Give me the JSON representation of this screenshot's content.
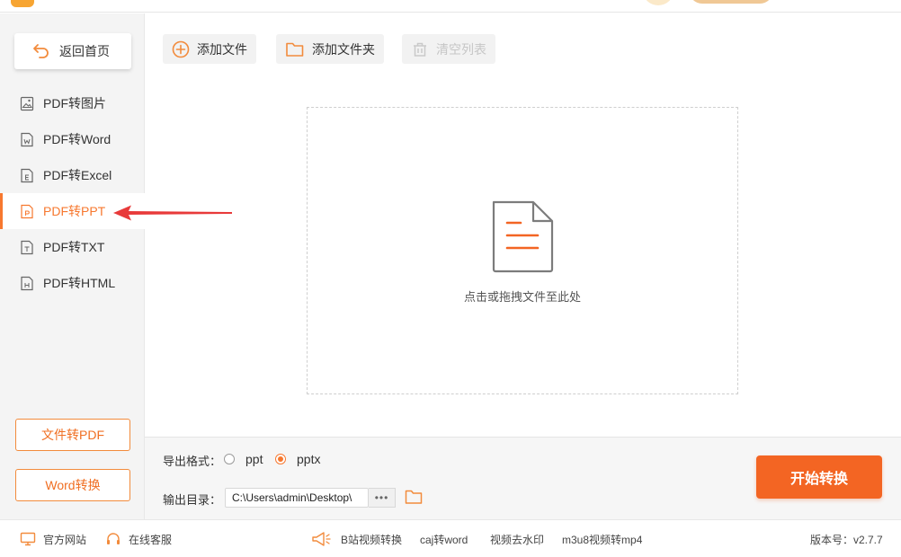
{
  "sidebar": {
    "back_label": "返回首页",
    "items": [
      {
        "label": "PDF转图片",
        "icon": "image-file-icon"
      },
      {
        "label": "PDF转Word",
        "icon": "word-file-icon"
      },
      {
        "label": "PDF转Excel",
        "icon": "excel-file-icon"
      },
      {
        "label": "PDF转PPT",
        "icon": "ppt-file-icon",
        "active": true
      },
      {
        "label": "PDF转TXT",
        "icon": "txt-file-icon"
      },
      {
        "label": "PDF转HTML",
        "icon": "html-file-icon"
      }
    ],
    "bottom_buttons": [
      "文件转PDF",
      "Word转换"
    ]
  },
  "toolbar": {
    "add_file": "添加文件",
    "add_folder": "添加文件夹",
    "clear_list": "清空列表"
  },
  "dropzone": {
    "hint": "点击或拖拽文件至此处"
  },
  "options": {
    "format_label": "导出格式：",
    "formats": [
      {
        "label": "ppt",
        "checked": false
      },
      {
        "label": "pptx",
        "checked": true
      }
    ],
    "output_label": "输出目录：",
    "output_path": "C:\\Users\\admin\\Desktop\\",
    "more": "•••",
    "start": "开始转换"
  },
  "footer": {
    "website": "官方网站",
    "support": "在线客服",
    "links": [
      "B站视频转换",
      "caj转word",
      "视频去水印",
      "m3u8视频转mp4"
    ],
    "version": "版本号：v2.7.7"
  },
  "colors": {
    "accent": "#f7782f",
    "start_button": "#f36523",
    "annotation_arrow": "#e83a3a"
  }
}
